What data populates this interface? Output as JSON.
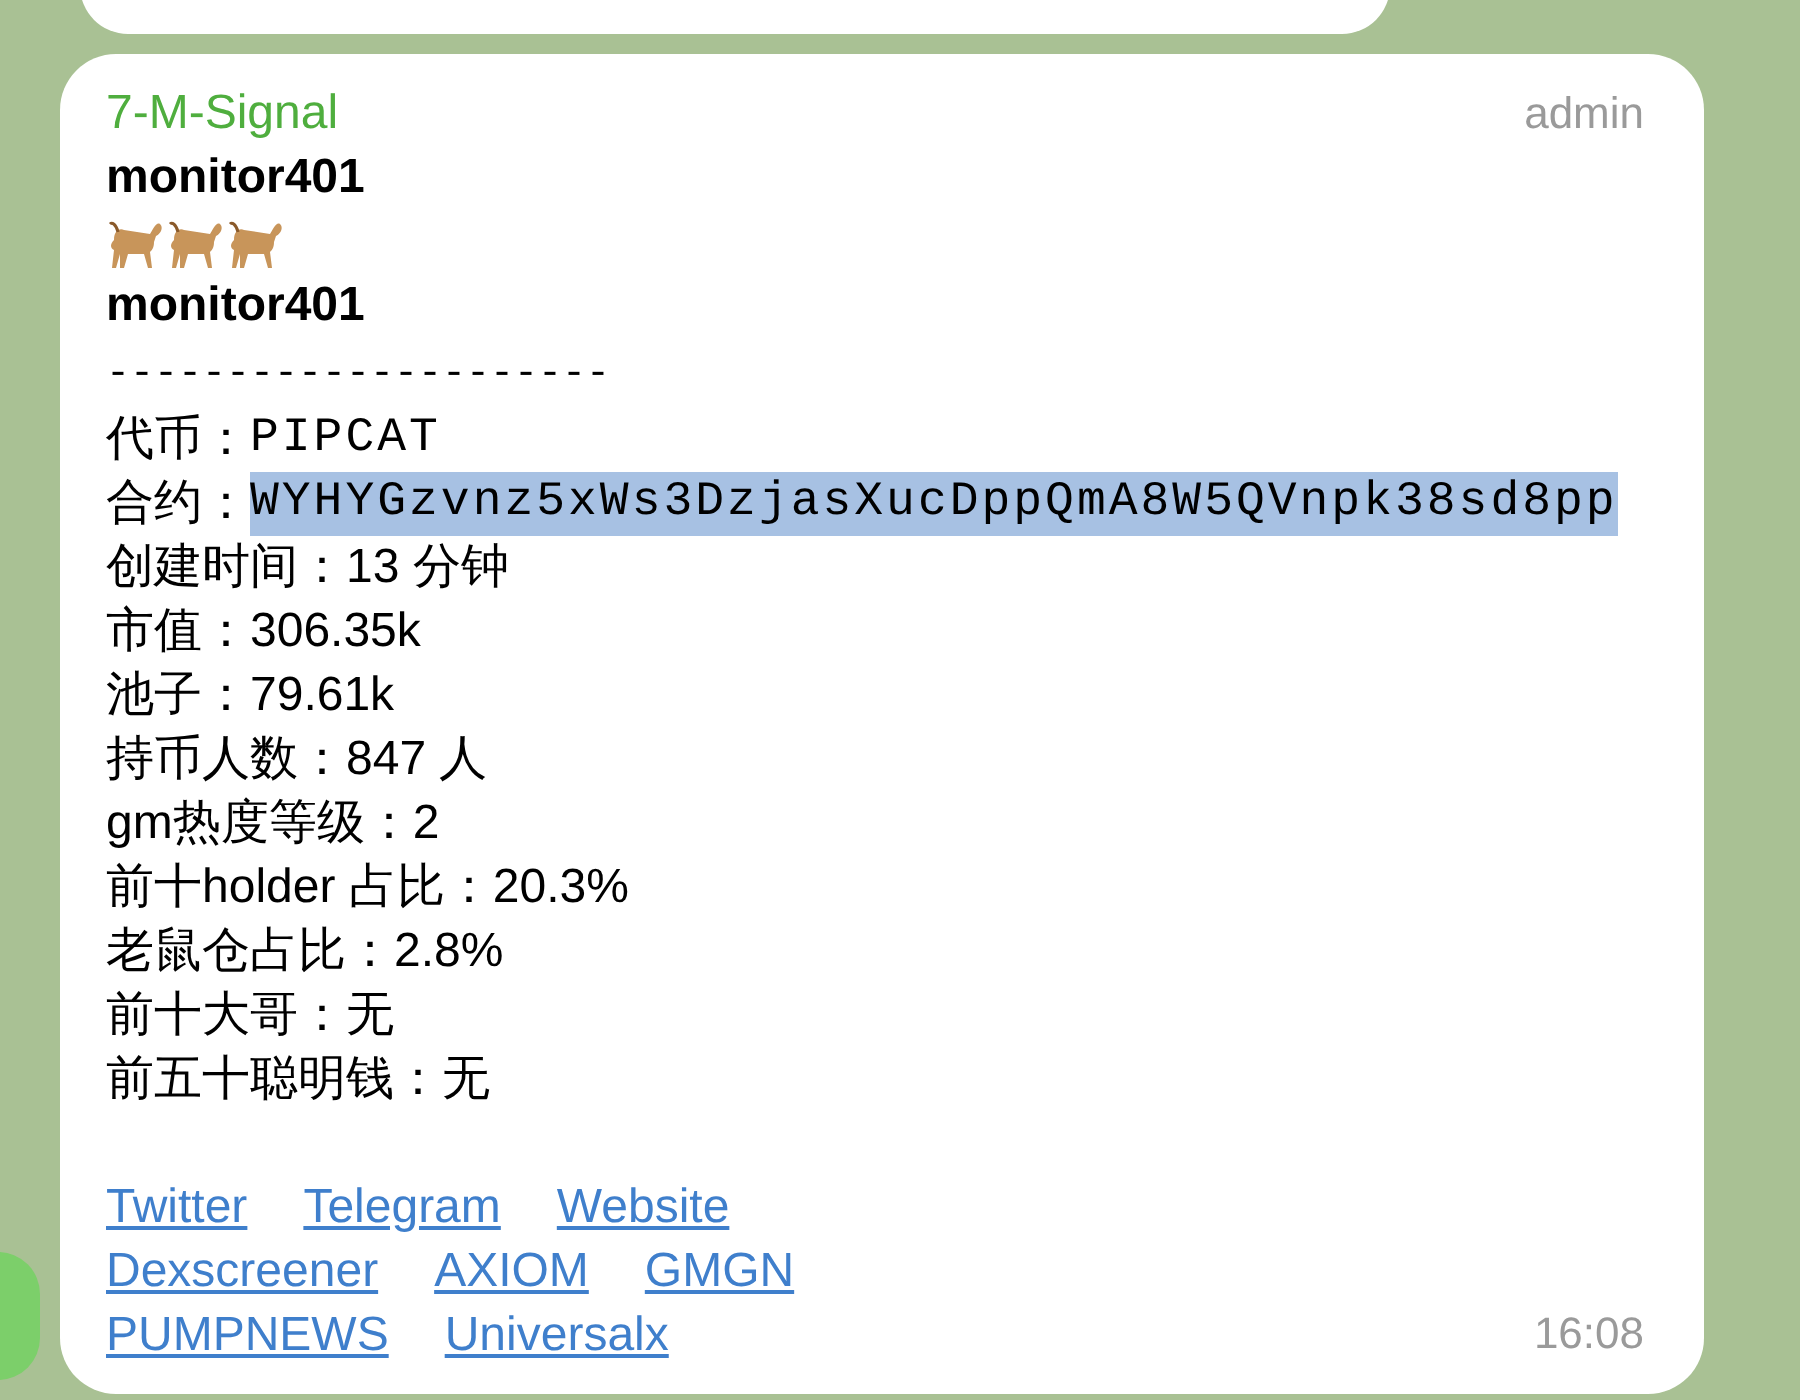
{
  "message": {
    "sender": "7-M-Signal",
    "role": "admin",
    "lines": [
      {
        "kind": "bold",
        "text": "monitor401"
      },
      {
        "kind": "dogs",
        "count_icons": [
          {
            "kind": "dog"
          },
          {
            "kind": "dog"
          },
          {
            "kind": "dog"
          }
        ]
      },
      {
        "kind": "bold",
        "text": "monitor401"
      },
      {
        "kind": "rule",
        "text": "---------------------"
      }
    ],
    "fields": [
      {
        "label": "代币：",
        "value": "PIPCAT",
        "kind": "mono",
        "selected": false
      },
      {
        "label": "合约：",
        "value": "WYHYGzvnz5xWs3DzjasXucDppQmA8W5QVnpk38sd8pp",
        "kind": "mono",
        "selected": true
      },
      {
        "label": "创建时间：",
        "value": "13 分钟",
        "kind": "sans",
        "selected": false
      },
      {
        "label": "市值：",
        "value": "306.35k",
        "kind": "sans",
        "selected": false
      },
      {
        "label": "池子：",
        "value": "79.61k",
        "kind": "sans",
        "selected": false
      },
      {
        "label": "持币人数：",
        "value": "847 人",
        "kind": "sans",
        "selected": false
      },
      {
        "label": "gm热度等级：",
        "value": "2",
        "kind": "sans",
        "selected": false
      },
      {
        "label": "前十holder 占比：",
        "value": "20.3%",
        "kind": "sans",
        "selected": false
      },
      {
        "label": "老鼠仓占比：",
        "value": "2.8%",
        "kind": "sans",
        "selected": false
      },
      {
        "label": "前十大哥：",
        "value": "无",
        "kind": "sans",
        "selected": false
      },
      {
        "label": "前五十聪明钱：",
        "value": "无",
        "kind": "sans",
        "selected": false
      }
    ],
    "link_rows": [
      [
        "Twitter",
        "Telegram",
        "Website"
      ],
      [
        "Dexscreener",
        "AXIOM",
        "GMGN"
      ],
      [
        "PUMPNEWS",
        "Universalx"
      ]
    ],
    "time": "16:08"
  }
}
